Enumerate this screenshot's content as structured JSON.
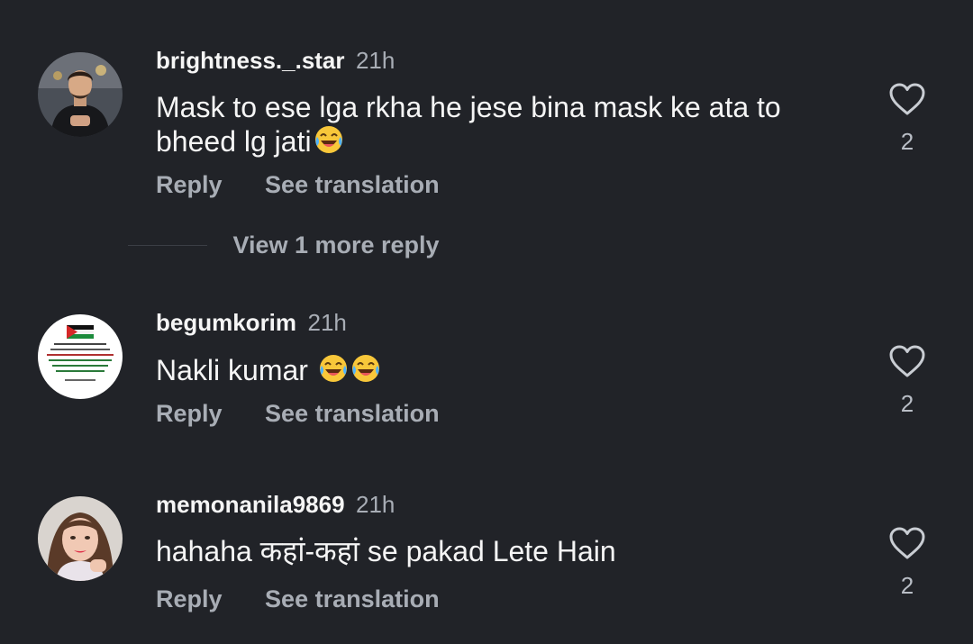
{
  "comments": [
    {
      "username": "brightness._.star",
      "time": "21h",
      "text_line1": "Mask to ese lga rkha he jese bina mask ke ata to",
      "text_line2": "bheed lg jati",
      "emoji": [
        "laughing-tears"
      ],
      "reply_label": "Reply",
      "see_translation_label": "See translation",
      "likes": "2",
      "view_more_label": "View 1 more reply",
      "avatar": "man-in-black-jacket"
    },
    {
      "username": "begumkorim",
      "time": "21h",
      "text_line1": "Nakli kumar ",
      "emoji": [
        "laughing-tears",
        "laughing-tears"
      ],
      "reply_label": "Reply",
      "see_translation_label": "See translation",
      "likes": "2",
      "avatar": "palestine-flag-quote"
    },
    {
      "username": "memonanila9869",
      "time": "21h",
      "text_line1": "hahaha कहां-कहां se pakad Lete Hain",
      "reply_label": "Reply",
      "see_translation_label": "See translation",
      "likes": "2",
      "avatar": "woman-portrait"
    }
  ],
  "colors": {
    "background": "#212328",
    "primary_text": "#f5f5f5",
    "secondary_text": "#a8adb5"
  }
}
